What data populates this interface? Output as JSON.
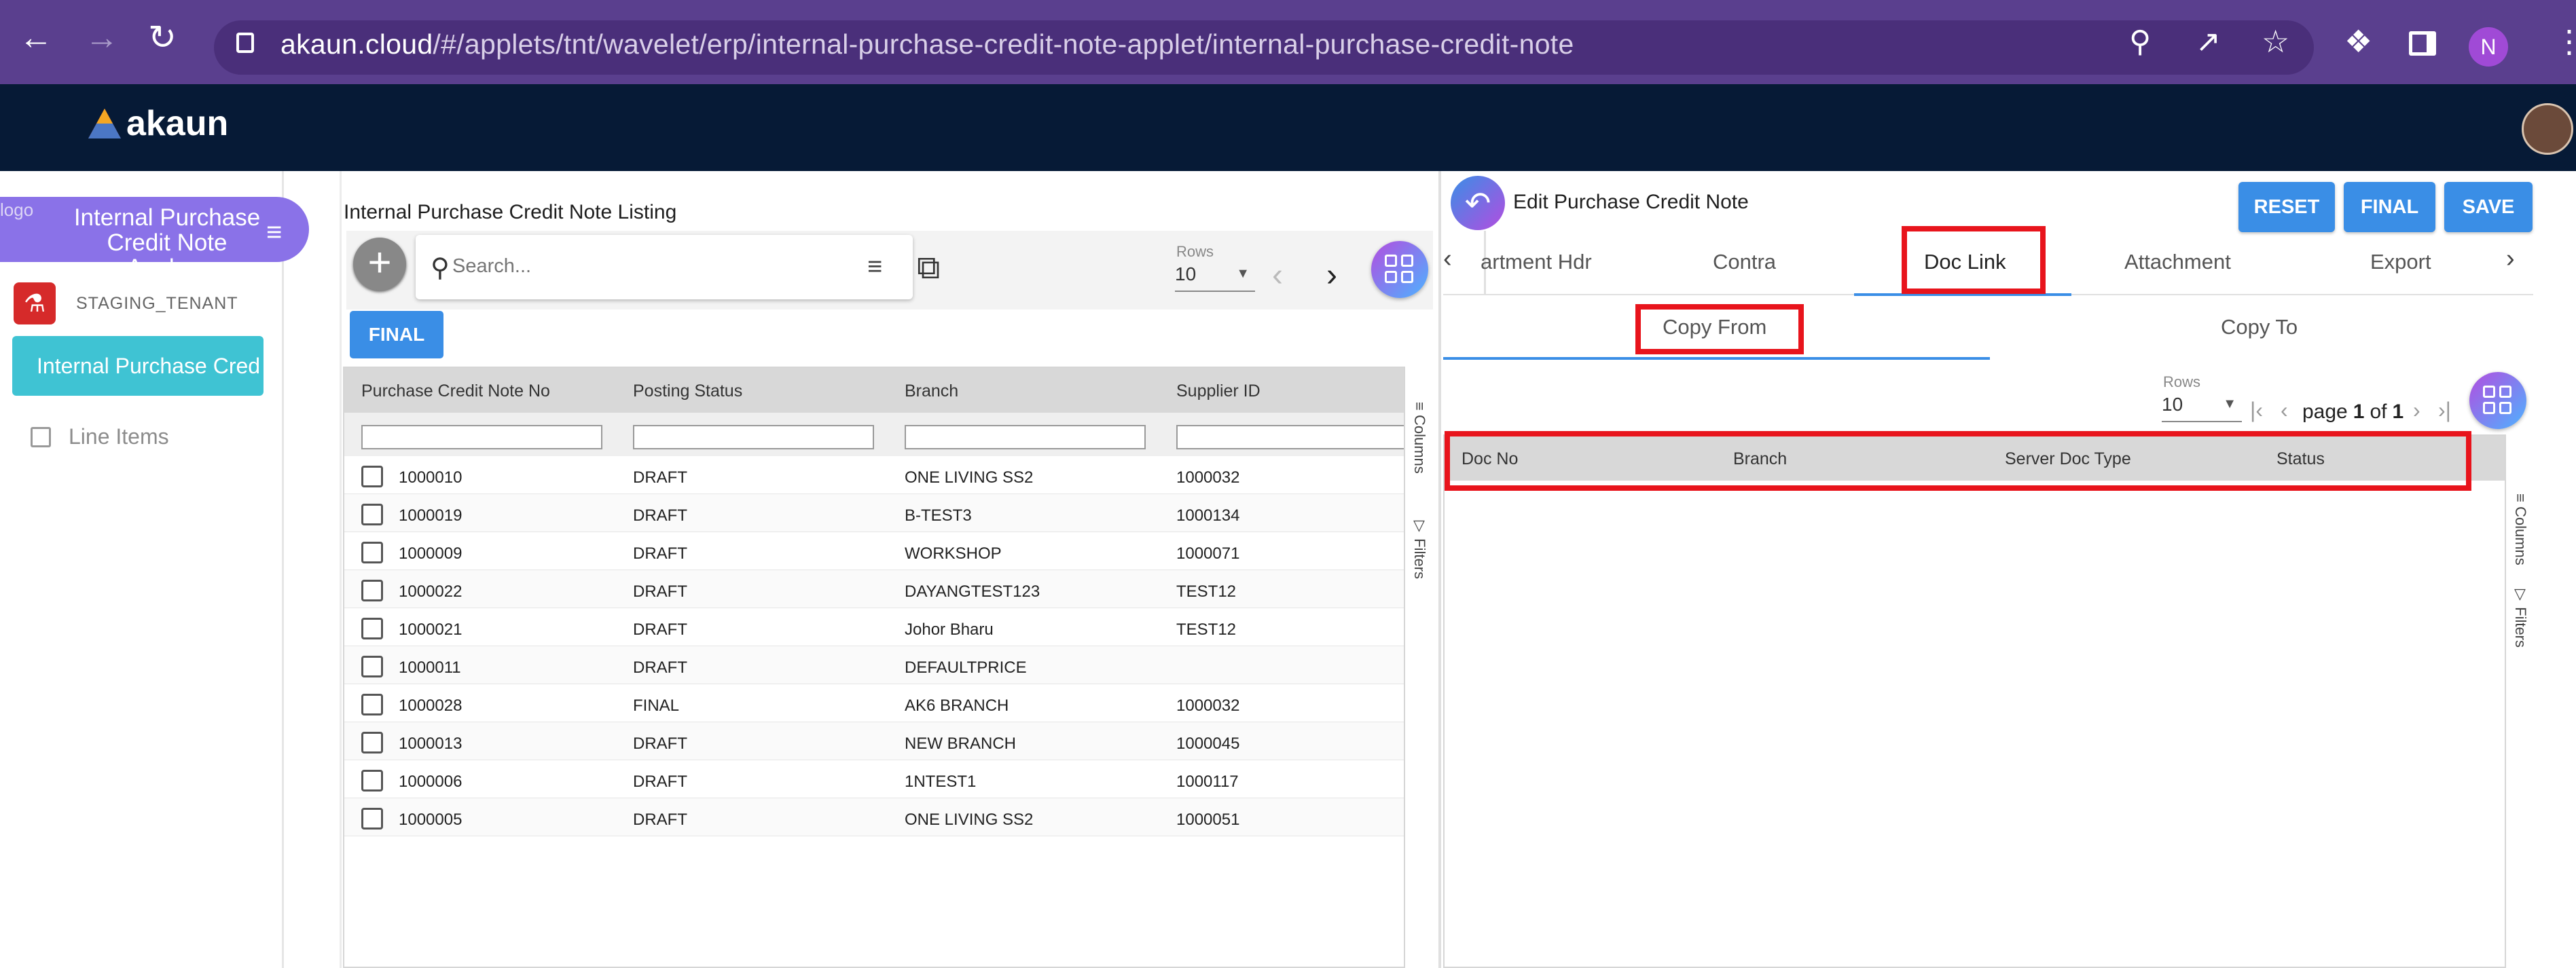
{
  "browser": {
    "url_host": "akaun.cloud",
    "url_path": "/#/applets/tnt/wavelet/erp/internal-purchase-credit-note-applet/internal-purchase-credit-note",
    "profile_initial": "N"
  },
  "header": {
    "logo_text": "akaun"
  },
  "sidebar": {
    "app_title": "Internal Purchase Credit Note Apple...",
    "logo_alt": "logo",
    "tenant": "STAGING_TENANT",
    "current_item": "Internal Purchase Cred",
    "line_items": "Line Items"
  },
  "listing": {
    "title": "Internal Purchase Credit Note Listing",
    "search_placeholder": "Search...",
    "rows_label": "Rows",
    "rows_value": "10",
    "final_button": "FINAL",
    "columns": [
      "Purchase Credit Note No",
      "Posting Status",
      "Branch",
      "Supplier ID"
    ],
    "rows": [
      {
        "no": "1000010",
        "status": "DRAFT",
        "branch": "ONE LIVING SS2",
        "supplier": "1000032"
      },
      {
        "no": "1000019",
        "status": "DRAFT",
        "branch": "B-TEST3",
        "supplier": "1000134"
      },
      {
        "no": "1000009",
        "status": "DRAFT",
        "branch": "WORKSHOP",
        "supplier": "1000071"
      },
      {
        "no": "1000022",
        "status": "DRAFT",
        "branch": "DAYANGTEST123",
        "supplier": "TEST12"
      },
      {
        "no": "1000021",
        "status": "DRAFT",
        "branch": "Johor Bharu",
        "supplier": "TEST12"
      },
      {
        "no": "1000011",
        "status": "DRAFT",
        "branch": "DEFAULTPRICE",
        "supplier": ""
      },
      {
        "no": "1000028",
        "status": "FINAL",
        "branch": "AK6 BRANCH",
        "supplier": "1000032"
      },
      {
        "no": "1000013",
        "status": "DRAFT",
        "branch": "NEW BRANCH",
        "supplier": "1000045"
      },
      {
        "no": "1000006",
        "status": "DRAFT",
        "branch": "1NTEST1",
        "supplier": "1000117"
      },
      {
        "no": "1000005",
        "status": "DRAFT",
        "branch": "ONE LIVING SS2",
        "supplier": "1000051"
      }
    ],
    "side_tabs": {
      "columns": "Columns",
      "filters": "Filters"
    }
  },
  "edit": {
    "title": "Edit Purchase Credit Note",
    "buttons": {
      "reset": "RESET",
      "final": "FINAL",
      "save": "SAVE"
    },
    "tabs": [
      "artment Hdr",
      "Contra",
      "Doc Link",
      "Attachment",
      "Export"
    ],
    "subtabs": {
      "copy_from": "Copy From",
      "copy_to": "Copy To"
    },
    "rows_label": "Rows",
    "rows_value": "10",
    "page_prefix": "page",
    "page_current": "1",
    "page_of": "of",
    "page_total": "1",
    "columns": [
      "Doc No",
      "Branch",
      "Server Doc Type",
      "Status"
    ],
    "side_tabs": {
      "columns": "Columns",
      "filters": "Filters"
    }
  },
  "colors": {
    "accent": "#3a8ee6",
    "highlight": "#e8141c",
    "header": "#061a36",
    "chrome": "#5a3f8e"
  }
}
